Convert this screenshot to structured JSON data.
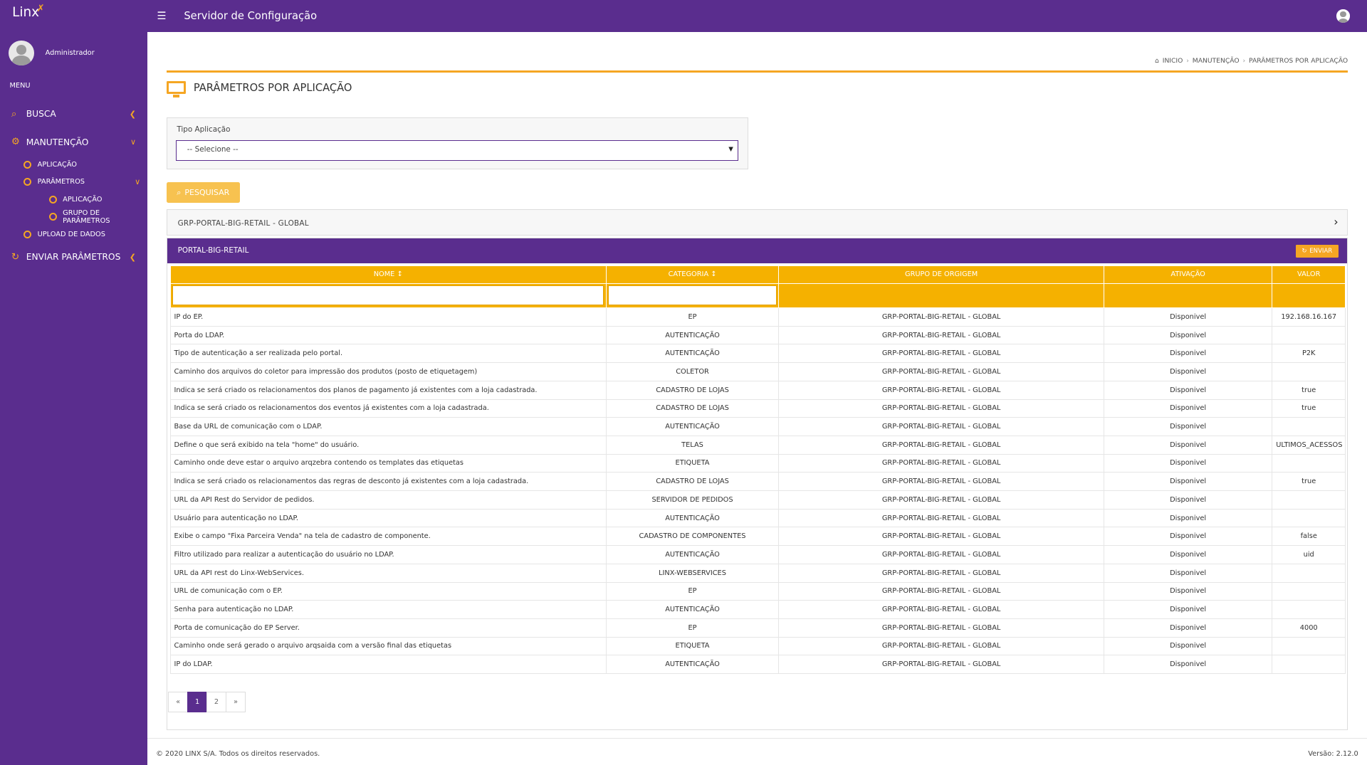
{
  "sidebar": {
    "logo": "Linx",
    "user_name": "Administrador",
    "menu_title": "MENU",
    "items": [
      {
        "label": "BUSCA"
      },
      {
        "label": "MANUTENÇÃO"
      },
      {
        "label": "ENVIAR PARÂMETROS"
      }
    ],
    "sub": {
      "aplicacao": "APLICAÇÃO",
      "parametros": "PARÂMETROS",
      "parametros_aplicacao": "APLICAÇÃO",
      "grupo_parametros": "GRUPO DE PARÂMETROS",
      "upload": "UPLOAD DE DADOS"
    }
  },
  "header": {
    "title": "Servidor de Configuração"
  },
  "breadcrumb": [
    "INICIO",
    "MANUTENÇÃO",
    "PARÂMETROS POR APLICAÇÃO"
  ],
  "page_title": "PARÂMETROS POR APLICAÇÃO",
  "filter": {
    "label": "Tipo Aplicação",
    "selected": "-- Selecione --"
  },
  "search_button": "PESQUISAR",
  "group_title": "GRP-PORTAL-BIG-RETAIL - GLOBAL",
  "panel": {
    "title": "PORTAL-BIG-RETAIL",
    "send_button": "ENVIAR",
    "columns": [
      "NOME",
      "CATEGORIA",
      "GRUPO DE ORGIGEM",
      "ATIVAÇÃO",
      "VALOR"
    ],
    "rows": [
      [
        "IP do EP.",
        "EP",
        "GRP-PORTAL-BIG-RETAIL - GLOBAL",
        "Disponivel",
        "192.168.16.167"
      ],
      [
        "Porta do LDAP.",
        "AUTENTICAÇÃO",
        "GRP-PORTAL-BIG-RETAIL - GLOBAL",
        "Disponivel",
        ""
      ],
      [
        "Tipo de autenticação a ser realizada pelo portal.",
        "AUTENTICAÇÃO",
        "GRP-PORTAL-BIG-RETAIL - GLOBAL",
        "Disponivel",
        "P2K"
      ],
      [
        "Caminho dos arquivos do coletor para impressão dos produtos (posto de etiquetagem)",
        "COLETOR",
        "GRP-PORTAL-BIG-RETAIL - GLOBAL",
        "Disponivel",
        ""
      ],
      [
        "Indica se será criado os relacionamentos dos planos de pagamento já existentes com a loja cadastrada.",
        "CADASTRO DE LOJAS",
        "GRP-PORTAL-BIG-RETAIL - GLOBAL",
        "Disponivel",
        "true"
      ],
      [
        "Indica se será criado os relacionamentos dos eventos já existentes com a loja cadastrada.",
        "CADASTRO DE LOJAS",
        "GRP-PORTAL-BIG-RETAIL - GLOBAL",
        "Disponivel",
        "true"
      ],
      [
        "Base da URL de comunicação com o LDAP.",
        "AUTENTICAÇÃO",
        "GRP-PORTAL-BIG-RETAIL - GLOBAL",
        "Disponivel",
        ""
      ],
      [
        "Define o que será exibido na tela \"home\" do usuário.",
        "TELAS",
        "GRP-PORTAL-BIG-RETAIL - GLOBAL",
        "Disponivel",
        "ULTIMOS_ACESSOS"
      ],
      [
        "Caminho onde deve estar o arquivo arqzebra contendo os templates das etiquetas",
        "ETIQUETA",
        "GRP-PORTAL-BIG-RETAIL - GLOBAL",
        "Disponivel",
        ""
      ],
      [
        "Indica se será criado os relacionamentos das regras de desconto já existentes com a loja cadastrada.",
        "CADASTRO DE LOJAS",
        "GRP-PORTAL-BIG-RETAIL - GLOBAL",
        "Disponivel",
        "true"
      ],
      [
        "URL da API Rest do Servidor de pedidos.",
        "SERVIDOR DE PEDIDOS",
        "GRP-PORTAL-BIG-RETAIL - GLOBAL",
        "Disponivel",
        ""
      ],
      [
        "Usuário para autenticação no LDAP.",
        "AUTENTICAÇÃO",
        "GRP-PORTAL-BIG-RETAIL - GLOBAL",
        "Disponivel",
        ""
      ],
      [
        "Exibe o campo \"Fixa Parceira Venda\" na tela de cadastro de componente.",
        "CADASTRO DE COMPONENTES",
        "GRP-PORTAL-BIG-RETAIL - GLOBAL",
        "Disponivel",
        "false"
      ],
      [
        "Filtro utilizado para realizar a autenticação do usuário no LDAP.",
        "AUTENTICAÇÃO",
        "GRP-PORTAL-BIG-RETAIL - GLOBAL",
        "Disponivel",
        "uid"
      ],
      [
        "URL da API rest do Linx-WebServices.",
        "LINX-WEBSERVICES",
        "GRP-PORTAL-BIG-RETAIL - GLOBAL",
        "Disponivel",
        ""
      ],
      [
        "URL de comunicação com o EP.",
        "EP",
        "GRP-PORTAL-BIG-RETAIL - GLOBAL",
        "Disponivel",
        ""
      ],
      [
        "Senha para autenticação no LDAP.",
        "AUTENTICAÇÃO",
        "GRP-PORTAL-BIG-RETAIL - GLOBAL",
        "Disponivel",
        ""
      ],
      [
        "Porta de comunicação do EP Server.",
        "EP",
        "GRP-PORTAL-BIG-RETAIL - GLOBAL",
        "Disponivel",
        "4000"
      ],
      [
        "Caminho onde será gerado o arquivo arqsaida com a versão final das etiquetas",
        "ETIQUETA",
        "GRP-PORTAL-BIG-RETAIL - GLOBAL",
        "Disponivel",
        ""
      ],
      [
        "IP do LDAP.",
        "AUTENTICAÇÃO",
        "GRP-PORTAL-BIG-RETAIL - GLOBAL",
        "Disponivel",
        ""
      ]
    ]
  },
  "pagination": {
    "prev": "«",
    "pages": [
      "1",
      "2"
    ],
    "active": "1",
    "next": "»"
  },
  "footer": {
    "copyright": "© 2020 LINX S/A. Todos os direitos reservados.",
    "version": "Versão: 2.12.0"
  },
  "colors": {
    "primary": "#5a2d8e",
    "accent": "#f5a623",
    "table_header": "#f5b100"
  }
}
